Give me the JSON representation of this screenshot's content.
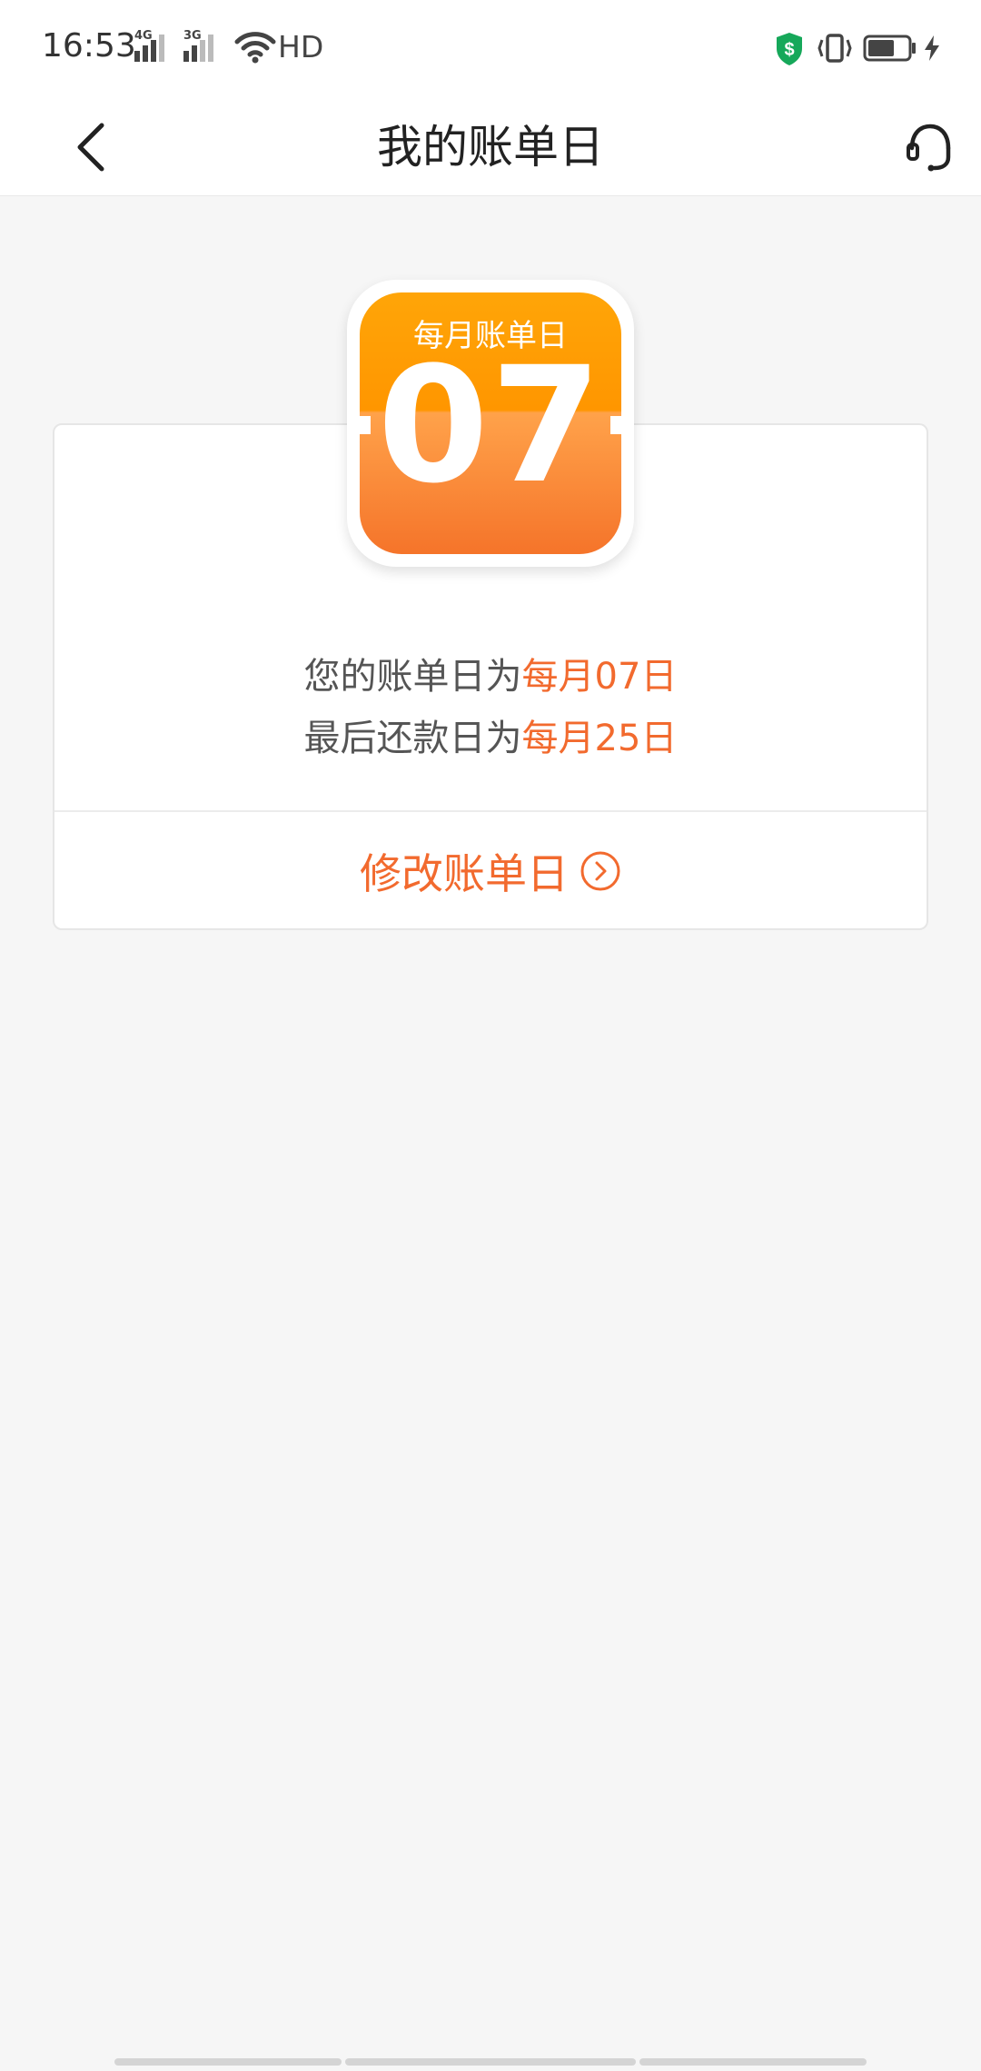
{
  "status_bar": {
    "time": "16:53",
    "signal1_tag": "4G",
    "signal2_tag": "3G",
    "hd_label": "HD",
    "shield_symbol": "$",
    "accent_green": "#16a85a"
  },
  "nav": {
    "title": "我的账单日"
  },
  "calendar": {
    "label": "每月账单日",
    "day": "07"
  },
  "info": {
    "bill_prefix": "您的账单日为",
    "bill_value": "每月07日",
    "due_prefix": "最后还款日为",
    "due_value": "每月25日"
  },
  "actions": {
    "modify_label": "修改账单日"
  },
  "colors": {
    "accent": "#f26a2e",
    "calendar_top": "#ff9f00",
    "calendar_bottom": "#f5742a",
    "background": "#f6f6f6"
  },
  "icons": {
    "back": "chevron-left-icon",
    "service": "headset-icon",
    "modify": "chevron-right-circle-icon"
  }
}
